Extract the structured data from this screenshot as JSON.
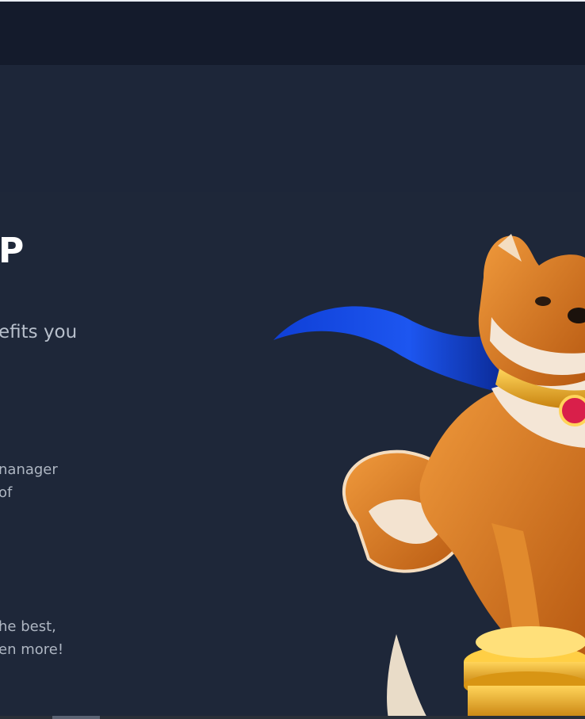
{
  "section": {
    "heading": "P",
    "intro": "efits you",
    "paragraphs": [
      [
        "nanager",
        "of"
      ],
      [
        "he best,",
        "en more!"
      ]
    ]
  },
  "mascot": {
    "icon": "shiba-inu-superhero-mascot",
    "description_colors": {
      "cape": "#1747e0",
      "fur": "#d8741c",
      "coin": "#f0b21a"
    }
  }
}
